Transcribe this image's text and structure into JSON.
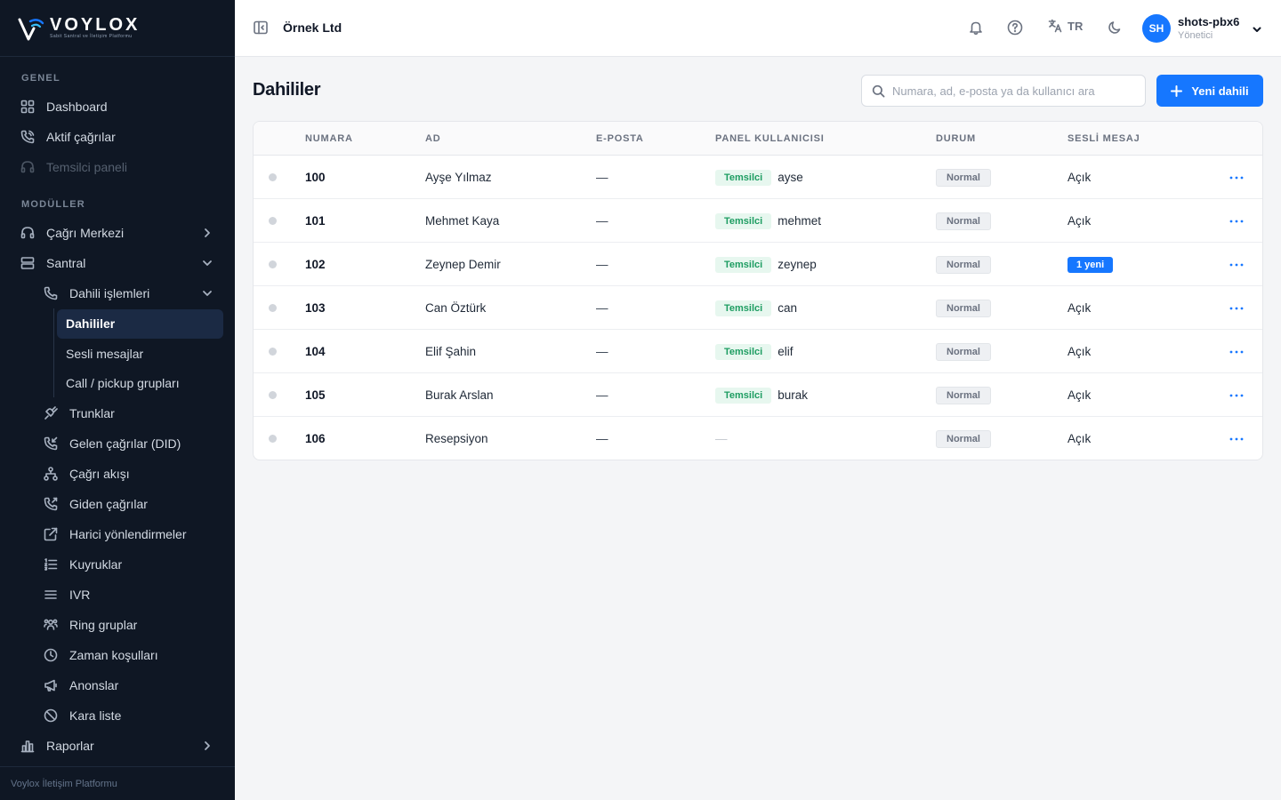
{
  "brand": {
    "name": "VOYLOX",
    "tagline": "Sabit Santral ve İletişim Platformu",
    "color": "#1677ff"
  },
  "sidebar": {
    "section_general": "GENEL",
    "section_modules": "MODÜLLER",
    "items": {
      "dashboard": "Dashboard",
      "active_calls": "Aktif çağrılar",
      "agent_panel": "Temsilci paneli",
      "call_center": "Çağrı Merkezi",
      "pbx": "Santral",
      "extension_ops": "Dahili işlemleri",
      "extensions": "Dahililer",
      "voicemails": "Sesli mesajlar",
      "pickup_groups": "Call / pickup grupları",
      "trunks": "Trunklar",
      "inbound": "Gelen çağrılar (DID)",
      "call_flow": "Çağrı akışı",
      "outbound": "Giden çağrılar",
      "external_routes": "Harici yönlendirmeler",
      "queues": "Kuyruklar",
      "ivr": "IVR",
      "ring_groups": "Ring gruplar",
      "time_conditions": "Zaman koşulları",
      "announcements": "Anonslar",
      "blacklist": "Kara liste",
      "reports": "Raporlar"
    },
    "footer": "Voylox İletişim Platformu"
  },
  "topbar": {
    "org": "Örnek Ltd",
    "language": "TR",
    "user": {
      "initials": "SH",
      "name": "shots-pbx6",
      "role": "Yönetici"
    }
  },
  "page": {
    "title": "Dahililer",
    "search_placeholder": "Numara, ad, e-posta ya da kullanıcı ara",
    "new_button": "Yeni dahili"
  },
  "table": {
    "headers": {
      "number": "NUMARA",
      "name": "AD",
      "email": "E-POSTA",
      "panel_user": "PANEL KULLANICISI",
      "status": "DURUM",
      "voicemail": "SESLİ MESAJ"
    },
    "rows": [
      {
        "number": "100",
        "name": "Ayşe Yılmaz",
        "email": "—",
        "role": "Temsilci",
        "username": "ayse",
        "status": "Normal",
        "voicemail": "Açık"
      },
      {
        "number": "101",
        "name": "Mehmet Kaya",
        "email": "—",
        "role": "Temsilci",
        "username": "mehmet",
        "status": "Normal",
        "voicemail": "Açık"
      },
      {
        "number": "102",
        "name": "Zeynep Demir",
        "email": "—",
        "role": "Temsilci",
        "username": "zeynep",
        "status": "Normal",
        "voicemail": "1 yeni"
      },
      {
        "number": "103",
        "name": "Can Öztürk",
        "email": "—",
        "role": "Temsilci",
        "username": "can",
        "status": "Normal",
        "voicemail": "Açık"
      },
      {
        "number": "104",
        "name": "Elif Şahin",
        "email": "—",
        "role": "Temsilci",
        "username": "elif",
        "status": "Normal",
        "voicemail": "Açık"
      },
      {
        "number": "105",
        "name": "Burak Arslan",
        "email": "—",
        "role": "Temsilci",
        "username": "burak",
        "status": "Normal",
        "voicemail": "Açık"
      },
      {
        "number": "106",
        "name": "Resepsiyon",
        "email": "—",
        "panel_empty": "—",
        "status": "Normal",
        "voicemail": "Açık"
      }
    ]
  }
}
